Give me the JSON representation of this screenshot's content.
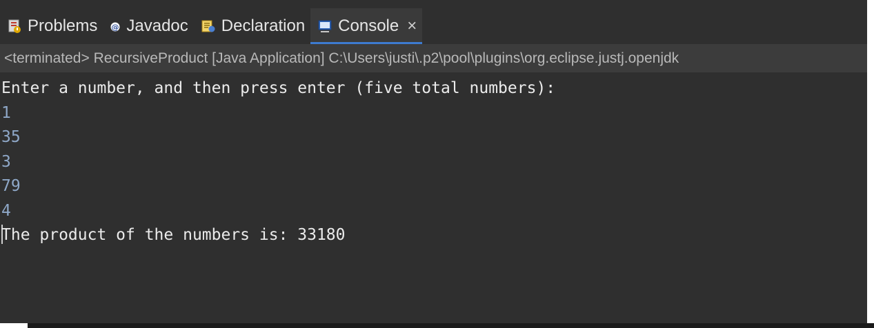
{
  "tabs": [
    {
      "label": "Problems",
      "icon": "problems-icon",
      "active": false
    },
    {
      "label": "Javadoc",
      "icon": "javadoc-icon",
      "active": false
    },
    {
      "label": "Declaration",
      "icon": "declaration-icon",
      "active": false
    },
    {
      "label": "Console",
      "icon": "console-icon",
      "active": true
    }
  ],
  "close_glyph": "×",
  "status": "<terminated> RecursiveProduct [Java Application] C:\\Users\\justi\\.p2\\pool\\plugins\\org.eclipse.justj.openjdk",
  "console": {
    "prompt": "Enter a number, and then press enter (five total numbers):",
    "inputs": [
      "1",
      "35",
      "3",
      "79",
      "4"
    ],
    "result": "The product of the numbers is: 33180"
  },
  "colors": {
    "background": "#2f2f2f",
    "output_text": "#ebebeb",
    "input_text": "#8fa8c8",
    "active_tab_underline": "#3d7bd1"
  }
}
